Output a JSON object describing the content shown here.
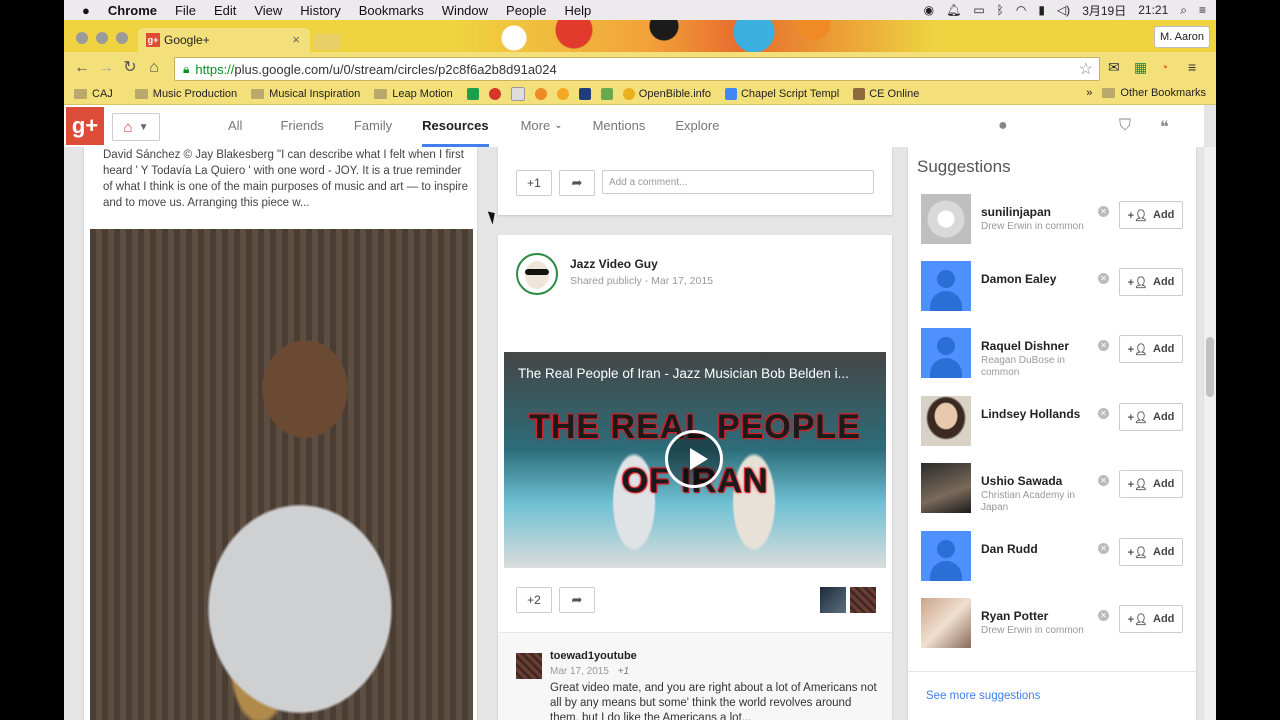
{
  "menubar": {
    "app": "Chrome",
    "items": [
      "File",
      "Edit",
      "View",
      "History",
      "Bookmarks",
      "Window",
      "People",
      "Help"
    ],
    "date": "3月19日",
    "time": "21:21"
  },
  "tab": {
    "title": "Google+",
    "fav": "g+",
    "close": "×"
  },
  "user_button": "M. Aaron",
  "omnibox": {
    "scheme": "https://",
    "rest": "plus.google.com/u/0/stream/circles/p2c8f6a2b8d91a024"
  },
  "bookmarks": {
    "items": [
      "CAJ",
      "Music Production",
      "Musical Inspiration",
      "Leap Motion",
      "OpenBible.info",
      "Chapel Script Templ",
      "CE Online"
    ],
    "overflow": "»",
    "other": "Other Bookmarks"
  },
  "gplus": {
    "logo": "g+",
    "nav": [
      "All",
      "Friends",
      "Family",
      "Resources",
      "More",
      "Mentions",
      "Explore"
    ],
    "active": "Resources"
  },
  "left_post": {
    "text": "David Sánchez © Jay Blakesberg \"I can describe what I felt when I first heard ' Y Todavía La Quiero ' with one word - JOY. It is a true reminder of what I think is one of the main purposes of music and art — to inspire and to move us. Arranging this piece w..."
  },
  "prev_post": {
    "plus": "+1",
    "comment_placeholder": "Add a comment..."
  },
  "post": {
    "author": "Jazz Video Guy",
    "visibility": "Shared publicly",
    "date": "Mar 17, 2015",
    "video_title": "The Real People of Iran - Jazz Musician Bob Belden i...",
    "video_big_line1": "THE REAL PEOPLE",
    "video_big_line2": "OF IRAN",
    "plus": "+2"
  },
  "comment": {
    "author": "toewad1youtube",
    "date": "Mar 17, 2015",
    "plus": "+1",
    "text": "Great video mate, and you are right about a lot of Americans not all by any means but some' think the world revolves around them, but I do like the Americans a lot..."
  },
  "suggestions": {
    "title": "Suggestions",
    "add_label": "Add",
    "items": [
      {
        "name": "sunilinjapan",
        "sub": "Drew Erwin in common",
        "avatar": "photo"
      },
      {
        "name": "Damon Ealey",
        "sub": "",
        "avatar": "default"
      },
      {
        "name": "Raquel Dishner",
        "sub": "Reagan DuBose in common",
        "avatar": "default"
      },
      {
        "name": "Lindsey Hollands",
        "sub": "",
        "avatar": "photo"
      },
      {
        "name": "Ushio Sawada",
        "sub": "Christian Academy in Japan",
        "avatar": "photo"
      },
      {
        "name": "Dan Rudd",
        "sub": "",
        "avatar": "default"
      },
      {
        "name": "Ryan Potter",
        "sub": "Drew Erwin in common",
        "avatar": "photo"
      }
    ],
    "see_more": "See more suggestions"
  },
  "colors": {
    "gplus_red": "#dd4b39",
    "accent_blue": "#427fed",
    "chrome_yellow": "#f4e07a"
  }
}
